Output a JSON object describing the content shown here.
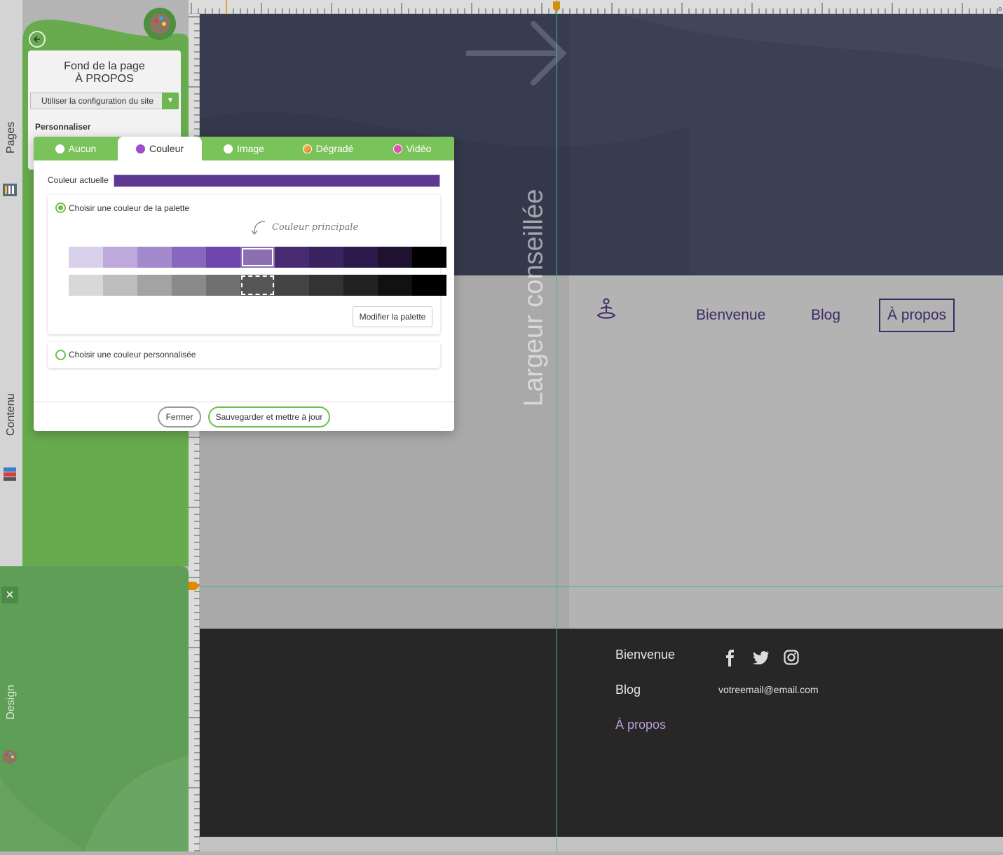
{
  "sidebar": {
    "tabs": [
      "Pages",
      "Contenu",
      "Design"
    ],
    "panel_title_1": "Fond de la page",
    "panel_title_2": "À PROPOS",
    "config_select": "Utiliser la configuration du site",
    "personnaliser": "Personnaliser"
  },
  "modal": {
    "tabs": [
      {
        "label": "Aucun",
        "color": "#ffffff"
      },
      {
        "label": "Couleur",
        "color": "#9b4dca"
      },
      {
        "label": "Image",
        "color": "#ffffff"
      },
      {
        "label": "Dégradé",
        "color": "#f4a64a"
      },
      {
        "label": "Vidéo",
        "color": "#e64bb0"
      }
    ],
    "active_tab": "Couleur",
    "current_color_label": "Couleur actuelle",
    "current_color": "#5d3993",
    "palette_option": "Choisir une couleur de la palette",
    "main_color_hint": "Couleur principale",
    "palette_row_1": [
      "#d9d0ea",
      "#bda9dc",
      "#a38acd",
      "#8a67be",
      "#6f45ae",
      "#8b6fb0",
      "#482a72",
      "#3a2460",
      "#2c1a4c",
      "#1e1230",
      "#000000"
    ],
    "palette_row_2": [
      "#d8d8d8",
      "#bdbdbd",
      "#a3a3a3",
      "#8a8a8a",
      "#707070",
      "#565656",
      "#444444",
      "#333333",
      "#222222",
      "#111111",
      "#000000"
    ],
    "modify_palette": "Modifier la palette",
    "custom_option": "Choisir une couleur personnalisée",
    "close": "Fermer",
    "save": "Sauvegarder et mettre à jour"
  },
  "canvas": {
    "recommended_width": "Largeur conseillée",
    "ruler_value": "0",
    "nav": [
      "Bienvenue",
      "Blog",
      "À propos"
    ],
    "footer_links": [
      "Bienvenue",
      "Blog",
      "À propos"
    ],
    "footer_email": "votreemail@email.com",
    "accent": "#3d2a67",
    "footer_active": "#b79ad6"
  }
}
